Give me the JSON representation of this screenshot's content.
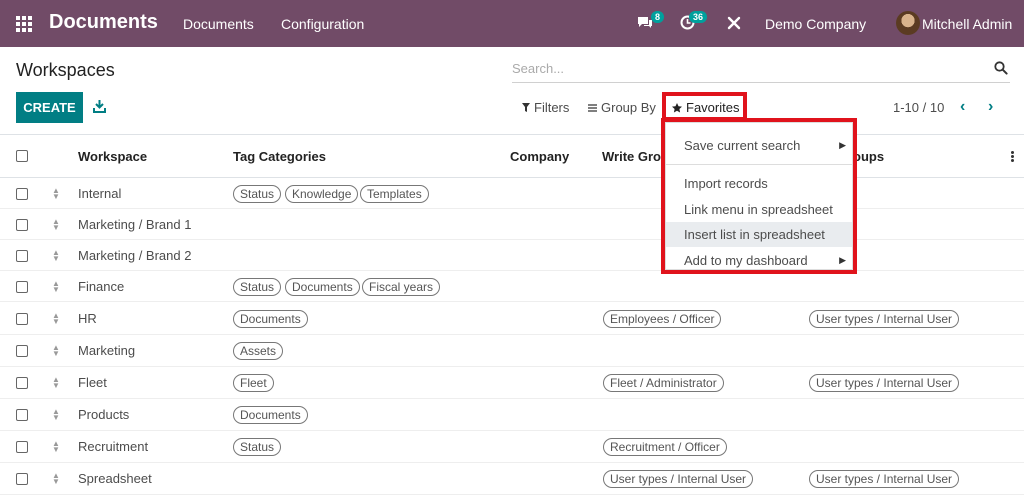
{
  "topbar": {
    "app_title": "Documents",
    "menu": [
      "Documents",
      "Configuration"
    ],
    "messages_count": "8",
    "activities_count": "36",
    "company": "Demo Company",
    "user": "Mitchell Admin",
    "colors": {
      "bar": "#714b67",
      "badge": "#00a09d"
    }
  },
  "control": {
    "page_title": "Workspaces",
    "search_placeholder": "Search...",
    "create_label": "CREATE",
    "filters_label": "Filters",
    "group_by_label": "Group By",
    "favorites_label": "Favorites",
    "pager": "1-10 / 10",
    "accent": "#017e84",
    "highlight": "#e0131c"
  },
  "table": {
    "headers": [
      "Workspace",
      "Tag Categories",
      "Company",
      "Write Grou",
      "oups"
    ],
    "rows": [
      {
        "name": "Internal",
        "tags": [
          "Status",
          "Knowledge",
          "Templates"
        ],
        "write": "",
        "read": ""
      },
      {
        "name": "Marketing / Brand 1",
        "tags": [],
        "write": "",
        "read": ""
      },
      {
        "name": "Marketing / Brand 2",
        "tags": [],
        "write": "",
        "read": ""
      },
      {
        "name": "Finance",
        "tags": [
          "Status",
          "Documents",
          "Fiscal years"
        ],
        "write": "",
        "read": ""
      },
      {
        "name": "HR",
        "tags": [
          "Documents"
        ],
        "write": "Employees / Officer",
        "read": "User types / Internal User"
      },
      {
        "name": "Marketing",
        "tags": [
          "Assets"
        ],
        "write": "",
        "read": ""
      },
      {
        "name": "Fleet",
        "tags": [
          "Fleet"
        ],
        "write": "Fleet / Administrator",
        "read": "User types / Internal User"
      },
      {
        "name": "Products",
        "tags": [
          "Documents"
        ],
        "write": "",
        "read": ""
      },
      {
        "name": "Recruitment",
        "tags": [
          "Status"
        ],
        "write": "Recruitment / Officer",
        "read": ""
      },
      {
        "name": "Spreadsheet",
        "tags": [],
        "write": "User types / Internal User",
        "read": "User types / Internal User"
      }
    ]
  },
  "favorites_menu": {
    "items": [
      {
        "label": "Save current search",
        "submenu": true
      },
      {
        "label": "Import records",
        "submenu": false
      },
      {
        "label": "Link menu in spreadsheet",
        "submenu": false
      },
      {
        "label": "Insert list in spreadsheet",
        "submenu": false,
        "highlighted": true
      },
      {
        "label": "Add to my dashboard",
        "submenu": true
      }
    ]
  }
}
